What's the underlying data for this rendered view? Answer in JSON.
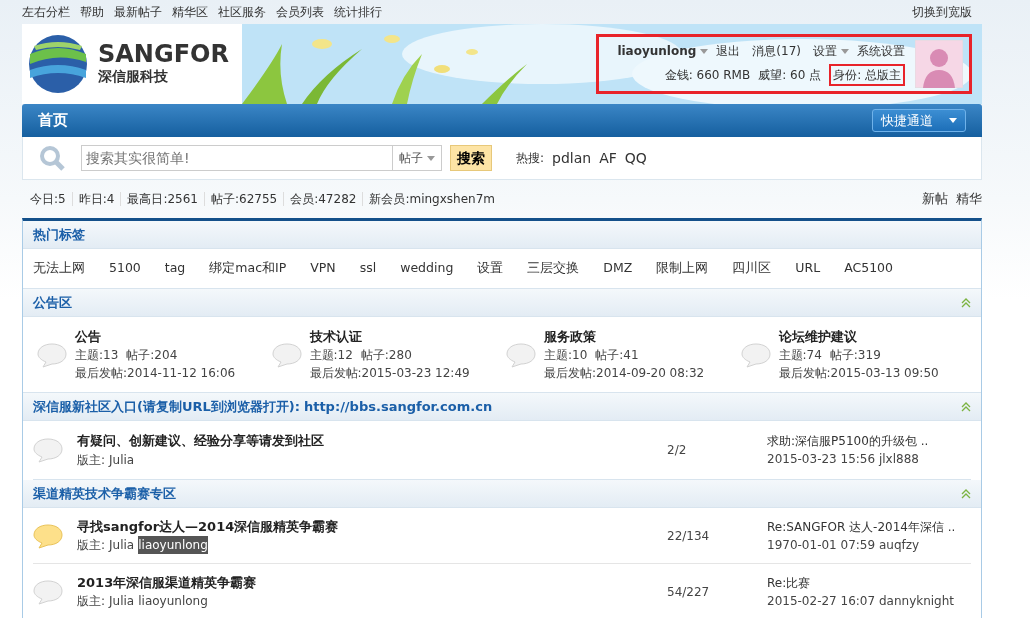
{
  "top_links": [
    "左右分栏",
    "帮助",
    "最新帖子",
    "精华区",
    "社区服务",
    "会员列表",
    "统计排行"
  ],
  "switch_link": "切换到宽版",
  "logo": {
    "name": "SANGFOR",
    "subtitle": "深信服科技"
  },
  "user_panel": {
    "annotated": true,
    "username": "liaoyunlong",
    "links": [
      {
        "label": "退出",
        "dropdown": false
      },
      {
        "label": "消息(17)",
        "dropdown": false
      },
      {
        "label": "设置",
        "dropdown": true
      },
      {
        "label": "系统设置",
        "dropdown": false
      }
    ],
    "stats": [
      {
        "label": "金钱:",
        "value": "660 RMB",
        "annotated": false
      },
      {
        "label": "威望:",
        "value": "60 点",
        "annotated": false
      },
      {
        "label": "身份:",
        "value": "总版主",
        "annotated": true
      }
    ]
  },
  "nav": {
    "home": "首页",
    "quick": "快捷通道"
  },
  "search": {
    "placeholder": "搜索其实很简单!",
    "scope": "帖子",
    "button": "搜索",
    "hot_label": "热搜:",
    "hot": [
      "pdlan",
      "AF",
      "QQ"
    ]
  },
  "site_stats": [
    {
      "label": "今日:",
      "value": "5"
    },
    {
      "label": "昨日:",
      "value": "4"
    },
    {
      "label": "最高日:",
      "value": "2561"
    },
    {
      "label": "帖子:",
      "value": "62755"
    },
    {
      "label": "会员:",
      "value": "47282"
    },
    {
      "label": "新会员:",
      "value": "mingxshen7m"
    }
  ],
  "quick_links": [
    "新帖",
    "精华"
  ],
  "tags": {
    "title": "热门标签",
    "items": [
      "无法上网",
      "5100",
      "tag",
      "绑定mac和IP",
      "VPN",
      "ssl",
      "wedding",
      "设置",
      "三层交换",
      "DMZ",
      "限制上网",
      "四川区",
      "URL",
      "AC5100"
    ]
  },
  "sections": [
    {
      "kind": "grid",
      "title": "公告区",
      "forums": [
        {
          "name": "公告",
          "new": false,
          "topics": "主题:13",
          "posts": "帖子:204",
          "last": "最后发帖:2014-11-12 16:06"
        },
        {
          "name": "技术认证",
          "new": false,
          "topics": "主题:12",
          "posts": "帖子:280",
          "last": "最后发帖:2015-03-23 12:49"
        },
        {
          "name": "服务政策",
          "new": false,
          "topics": "主题:10",
          "posts": "帖子:41",
          "last": "最后发帖:2014-09-20 08:32"
        },
        {
          "name": "论坛维护建议",
          "new": false,
          "topics": "主题:74",
          "posts": "帖子:319",
          "last": "最后发帖:2015-03-13 09:50"
        }
      ]
    },
    {
      "kind": "list",
      "title": "深信服新社区入口(请复制URL到浏览器打开):",
      "link": "http://bbs.sangfor.com.cn",
      "forums": [
        {
          "name": "有疑问、创新建议、经验分享等请发到社区",
          "new": false,
          "mod_label": "版主:",
          "moderators": [
            {
              "name": "Julia",
              "selected": false
            }
          ],
          "counts": "2/2",
          "last_title": "求助:深信服P5100的升级包 ..",
          "last_meta": "2015-03-23 15:56 jlxl888"
        }
      ]
    },
    {
      "kind": "list",
      "title": "渠道精英技术争霸赛专区",
      "forums": [
        {
          "name": "寻找sangfor达人—2014深信服精英争霸赛",
          "new": true,
          "mod_label": "版主:",
          "moderators": [
            {
              "name": "Julia",
              "selected": false
            },
            {
              "name": "liaoyunlong",
              "selected": true
            }
          ],
          "counts": "22/134",
          "last_title": "Re:SANGFOR 达人-2014年深信 ..",
          "last_meta": "1970-01-01 07:59 auqfzy"
        },
        {
          "name": "2013年深信服渠道精英争霸赛",
          "new": false,
          "mod_label": "版主:",
          "moderators": [
            {
              "name": "Julia",
              "selected": false
            },
            {
              "name": "liaoyunlong",
              "selected": false
            }
          ],
          "counts": "54/227",
          "last_title": "Re:比赛",
          "last_meta": "2015-02-27 16:07 dannyknight"
        }
      ]
    }
  ]
}
